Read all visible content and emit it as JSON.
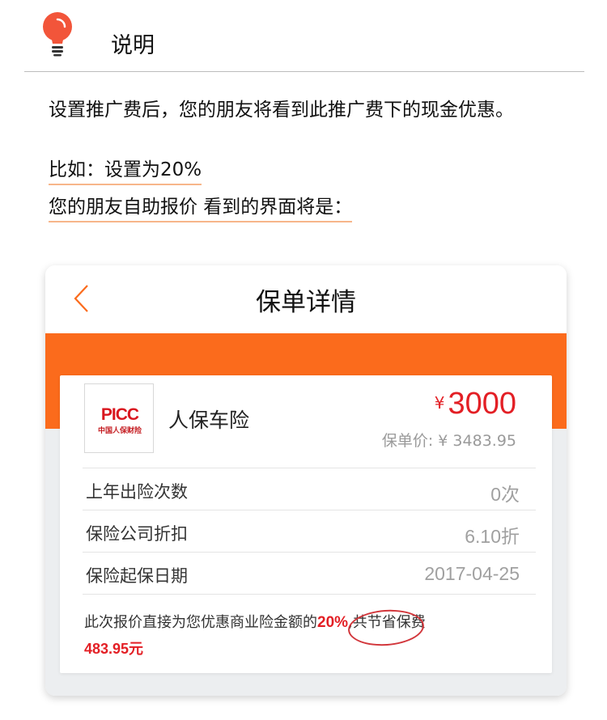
{
  "header": {
    "title": "说明",
    "icon": "lightbulb-icon"
  },
  "intro_text": "设置推广费后，您的朋友将看到此推广费下的现金优惠。",
  "example": {
    "line1": "比如：设置为20%",
    "line2": "您的朋友自助报价 看到的界面将是："
  },
  "phone": {
    "nav_title": "保单详情",
    "back_icon": "chevron-left-icon",
    "card": {
      "logo_text": "PICC",
      "logo_subtext": "中国人保财险",
      "company": "人保车险",
      "price_symbol": "¥",
      "price_value": "3000",
      "original_price": "保单价: ¥ 3483.95",
      "rows": [
        {
          "label": "上年出险次数",
          "value": "0次"
        },
        {
          "label": "保险公司折扣",
          "value": "6.10折"
        },
        {
          "label": "保险起保日期",
          "value": "2017-04-25"
        }
      ],
      "note": {
        "prefix": "此次报价直接为您优惠商业险金额的",
        "percent": "20%",
        "middle": ",共节省保费",
        "amount": "483.95元"
      }
    }
  },
  "colors": {
    "accent": "#fb6b1c",
    "price_red": "#e31f25",
    "underline": "#f7b68a"
  }
}
